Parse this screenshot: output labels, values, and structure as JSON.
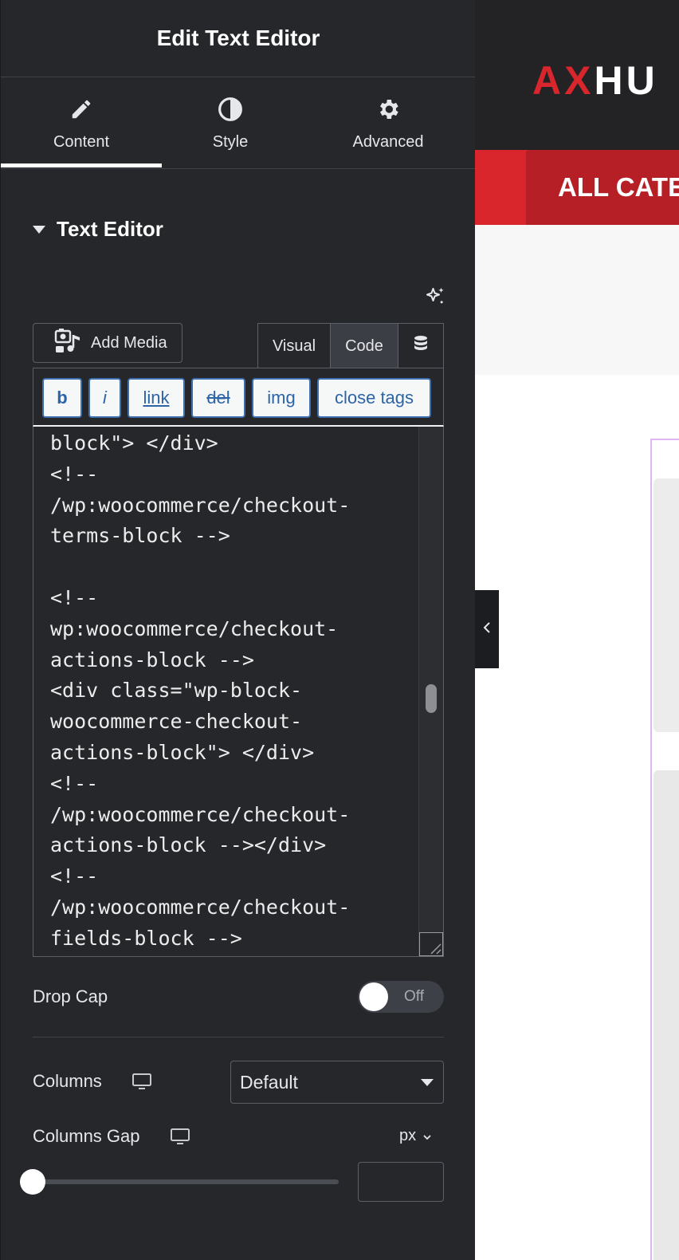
{
  "panel": {
    "title": "Edit Text Editor",
    "tabs": [
      {
        "label": "Content",
        "icon": "pencil-icon",
        "active": true
      },
      {
        "label": "Style",
        "icon": "contrast-icon",
        "active": false
      },
      {
        "label": "Advanced",
        "icon": "gear-icon",
        "active": false
      }
    ]
  },
  "section": {
    "title": "Text Editor"
  },
  "editor": {
    "add_media_label": "Add Media",
    "modes": {
      "visual": "Visual",
      "code": "Code",
      "active": "Code"
    },
    "quicktags": [
      "b",
      "i",
      "link",
      "del",
      "img",
      "close tags"
    ],
    "code_lines": [
      "block\"> </div>",
      "<!--",
      "/wp:woocommerce/checkout-",
      "terms-block -->",
      "",
      "<!--",
      "wp:woocommerce/checkout-",
      "actions-block -->",
      "<div class=\"wp-block-",
      "woocommerce-checkout-",
      "actions-block\"> </div>",
      "<!--",
      "/wp:woocommerce/checkout-",
      "actions-block --></div>",
      "<!--",
      "/wp:woocommerce/checkout-",
      "fields-block -->"
    ]
  },
  "controls": {
    "drop_cap": {
      "label": "Drop Cap",
      "state": "Off"
    },
    "columns": {
      "label": "Columns",
      "value": "Default"
    },
    "columns_gap": {
      "label": "Columns Gap",
      "unit": "px",
      "value": "",
      "slider_fraction": 0
    }
  },
  "preview": {
    "logo_part1": "AX",
    "logo_part2": "HU",
    "nav_button": "ALL CATE",
    "colors": {
      "accent": "#d8262c",
      "header": "#232325"
    }
  }
}
